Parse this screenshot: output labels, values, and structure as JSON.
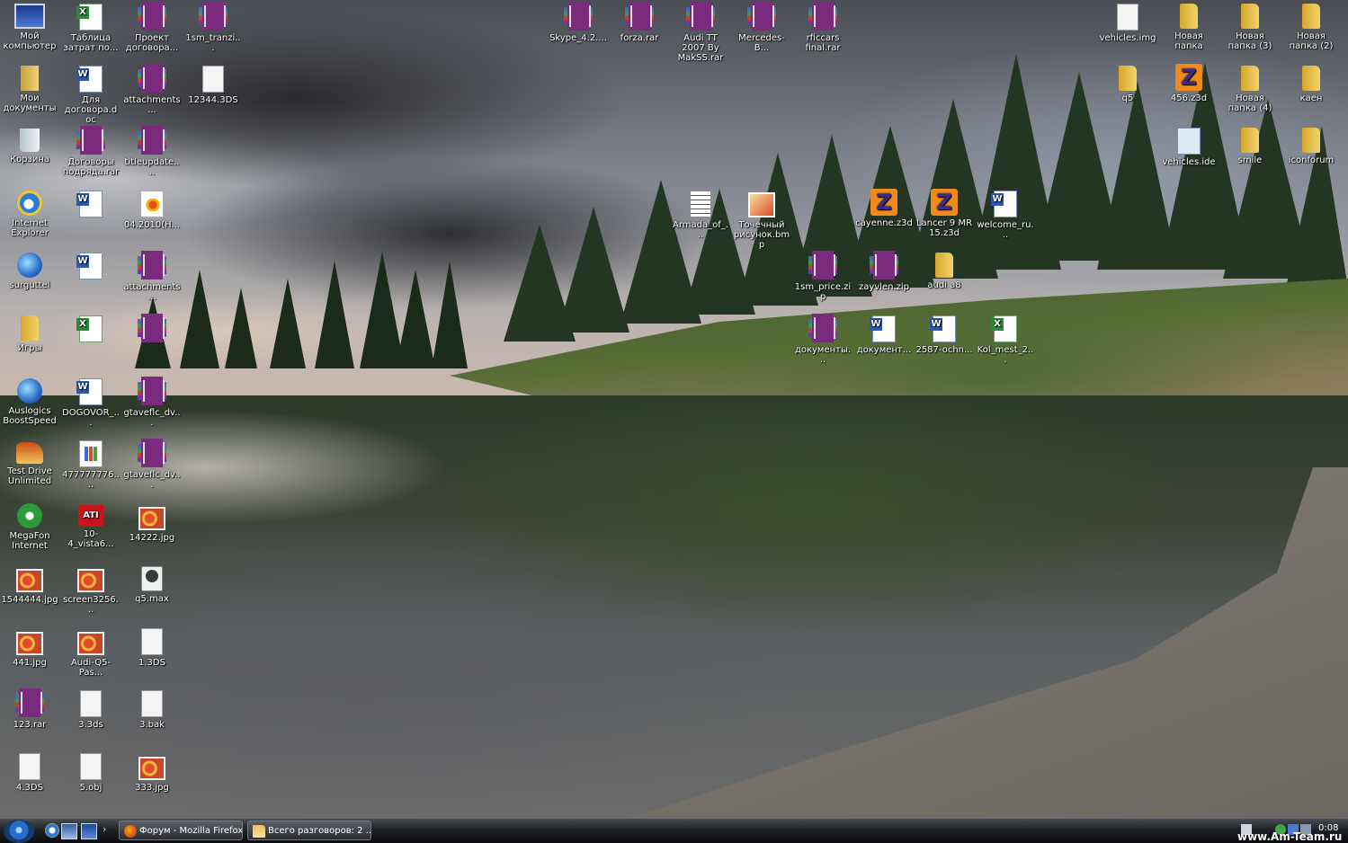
{
  "desktop_icons": [
    {
      "label": "Мой компьютер"
    },
    {
      "label": "Таблица затрат по..."
    },
    {
      "label": "Проект договора..."
    },
    {
      "label": "1sm_tranzi..."
    },
    {
      "label": "Мои документы"
    },
    {
      "label": "Для договора.doc"
    },
    {
      "label": "attachments..."
    },
    {
      "label": "12344.3DS"
    },
    {
      "label": "Корзина"
    },
    {
      "label": "Договоры подряда.rar"
    },
    {
      "label": "titleupdate...."
    },
    {
      "label": "Internet Explorer"
    },
    {
      "label": ""
    },
    {
      "label": "04.2010(H..."
    },
    {
      "label": "surguttel"
    },
    {
      "label": ""
    },
    {
      "label": "attachments..."
    },
    {
      "label": "Игры"
    },
    {
      "label": ""
    },
    {
      "label": ""
    },
    {
      "label": "Auslogics BoostSpeed"
    },
    {
      "label": "DOGOVOR_..."
    },
    {
      "label": "gtaveflc_dv..."
    },
    {
      "label": "Test Drive Unlimited"
    },
    {
      "label": "477777776...."
    },
    {
      "label": "gtaveflc_dv..."
    },
    {
      "label": "MegaFon Internet"
    },
    {
      "label": "10-4_vista6..."
    },
    {
      "label": "14222.jpg"
    },
    {
      "label": "1544444.jpg"
    },
    {
      "label": "screen3256..."
    },
    {
      "label": "q5.max"
    },
    {
      "label": "441.jpg"
    },
    {
      "label": "Audi-Q5-Pas..."
    },
    {
      "label": "1.3DS"
    },
    {
      "label": "123.rar"
    },
    {
      "label": "3.3ds"
    },
    {
      "label": "3.bak"
    },
    {
      "label": "4.3DS"
    },
    {
      "label": "5.obj"
    },
    {
      "label": "333.jpg"
    },
    {
      "label": "Skype_4.2...."
    },
    {
      "label": "forza.rar"
    },
    {
      "label": "Audi TT 2007 By MakSS.rar"
    },
    {
      "label": "Mercedes-B..."
    },
    {
      "label": "rficcars final.rar"
    },
    {
      "label": "Armada_of_..."
    },
    {
      "label": "Точечный рисунок.bmp"
    },
    {
      "label": "cayenne.z3d"
    },
    {
      "label": "Lancer 9 MR 15.z3d"
    },
    {
      "label": "welcome_ru..."
    },
    {
      "label": "1sm_price.zip"
    },
    {
      "label": "zayvlen.zip"
    },
    {
      "label": "audi a8"
    },
    {
      "label": "документы..."
    },
    {
      "label": "документ..."
    },
    {
      "label": "2587-ochn..."
    },
    {
      "label": "Kol_mest_2..."
    },
    {
      "label": "vehicles.img"
    },
    {
      "label": "Новая папка"
    },
    {
      "label": "Новая папка (3)"
    },
    {
      "label": "Новая папка (2)"
    },
    {
      "label": "q5"
    },
    {
      "label": "456.z3d"
    },
    {
      "label": "Новая папка (4)"
    },
    {
      "label": "каен"
    },
    {
      "label": "vehicles.ide"
    },
    {
      "label": "smile"
    },
    {
      "label": "iconforum"
    }
  ],
  "taskbar": {
    "tasks": [
      {
        "label": "Форум - Mozilla Firefox"
      },
      {
        "label": "Всего разговоров: 2 ..."
      }
    ],
    "clock": "0:08",
    "watermark": "www.Am-Team.ru",
    "quick_launch_more": "›"
  },
  "colors": {
    "taskbar_top": "#4a4d54",
    "taskbar_bottom": "#0c0d10",
    "icon_text": "#ffffff"
  }
}
